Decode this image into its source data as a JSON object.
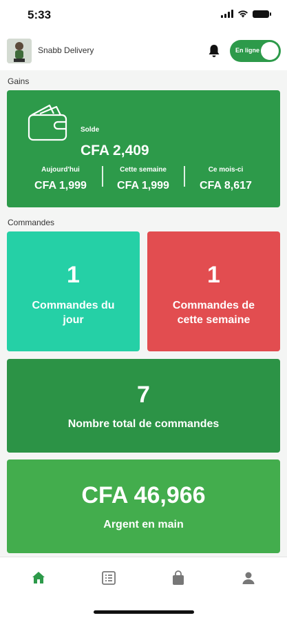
{
  "status_bar": {
    "time": "5:33",
    "icons": [
      "signal-icon",
      "wifi-icon",
      "battery-icon"
    ]
  },
  "header": {
    "brand_name": "Snabb Delivery",
    "avatar_icon": "avatar-image",
    "bell_icon": "bell-icon",
    "online_toggle": {
      "label": "En ligne",
      "on": true
    }
  },
  "gains": {
    "section_label": "Gains",
    "solde_label": "Solde",
    "solde_value": "CFA 2,409",
    "wallet_icon": "wallet-icon",
    "stats": [
      {
        "label": "Aujourd'hui",
        "value": "CFA 1,999"
      },
      {
        "label": "Cette semaine",
        "value": "CFA 1,999"
      },
      {
        "label": "Ce mois-ci",
        "value": "CFA 8,617"
      }
    ]
  },
  "commandes": {
    "section_label": "Commandes",
    "today": {
      "value": "1",
      "label_line1": "Commandes du",
      "label_line2": "jour"
    },
    "week": {
      "value": "1",
      "label_line1": "Commandes de",
      "label_line2": "cette semaine"
    },
    "total": {
      "value": "7",
      "label": "Nombre total de commandes"
    },
    "cash": {
      "value": "CFA 46,966",
      "label": "Argent en main"
    }
  },
  "tab_bar": {
    "items": [
      {
        "icon": "home-icon",
        "active": true
      },
      {
        "icon": "orders-list-icon",
        "active": false
      },
      {
        "icon": "shopping-bag-icon",
        "active": false
      },
      {
        "icon": "profile-icon",
        "active": false
      }
    ]
  },
  "colors": {
    "brand_green": "#2d9a4a",
    "teal": "#25d0a6",
    "red": "#e24d50",
    "dark_green": "#2c9346",
    "light_green": "#43ad4d"
  }
}
